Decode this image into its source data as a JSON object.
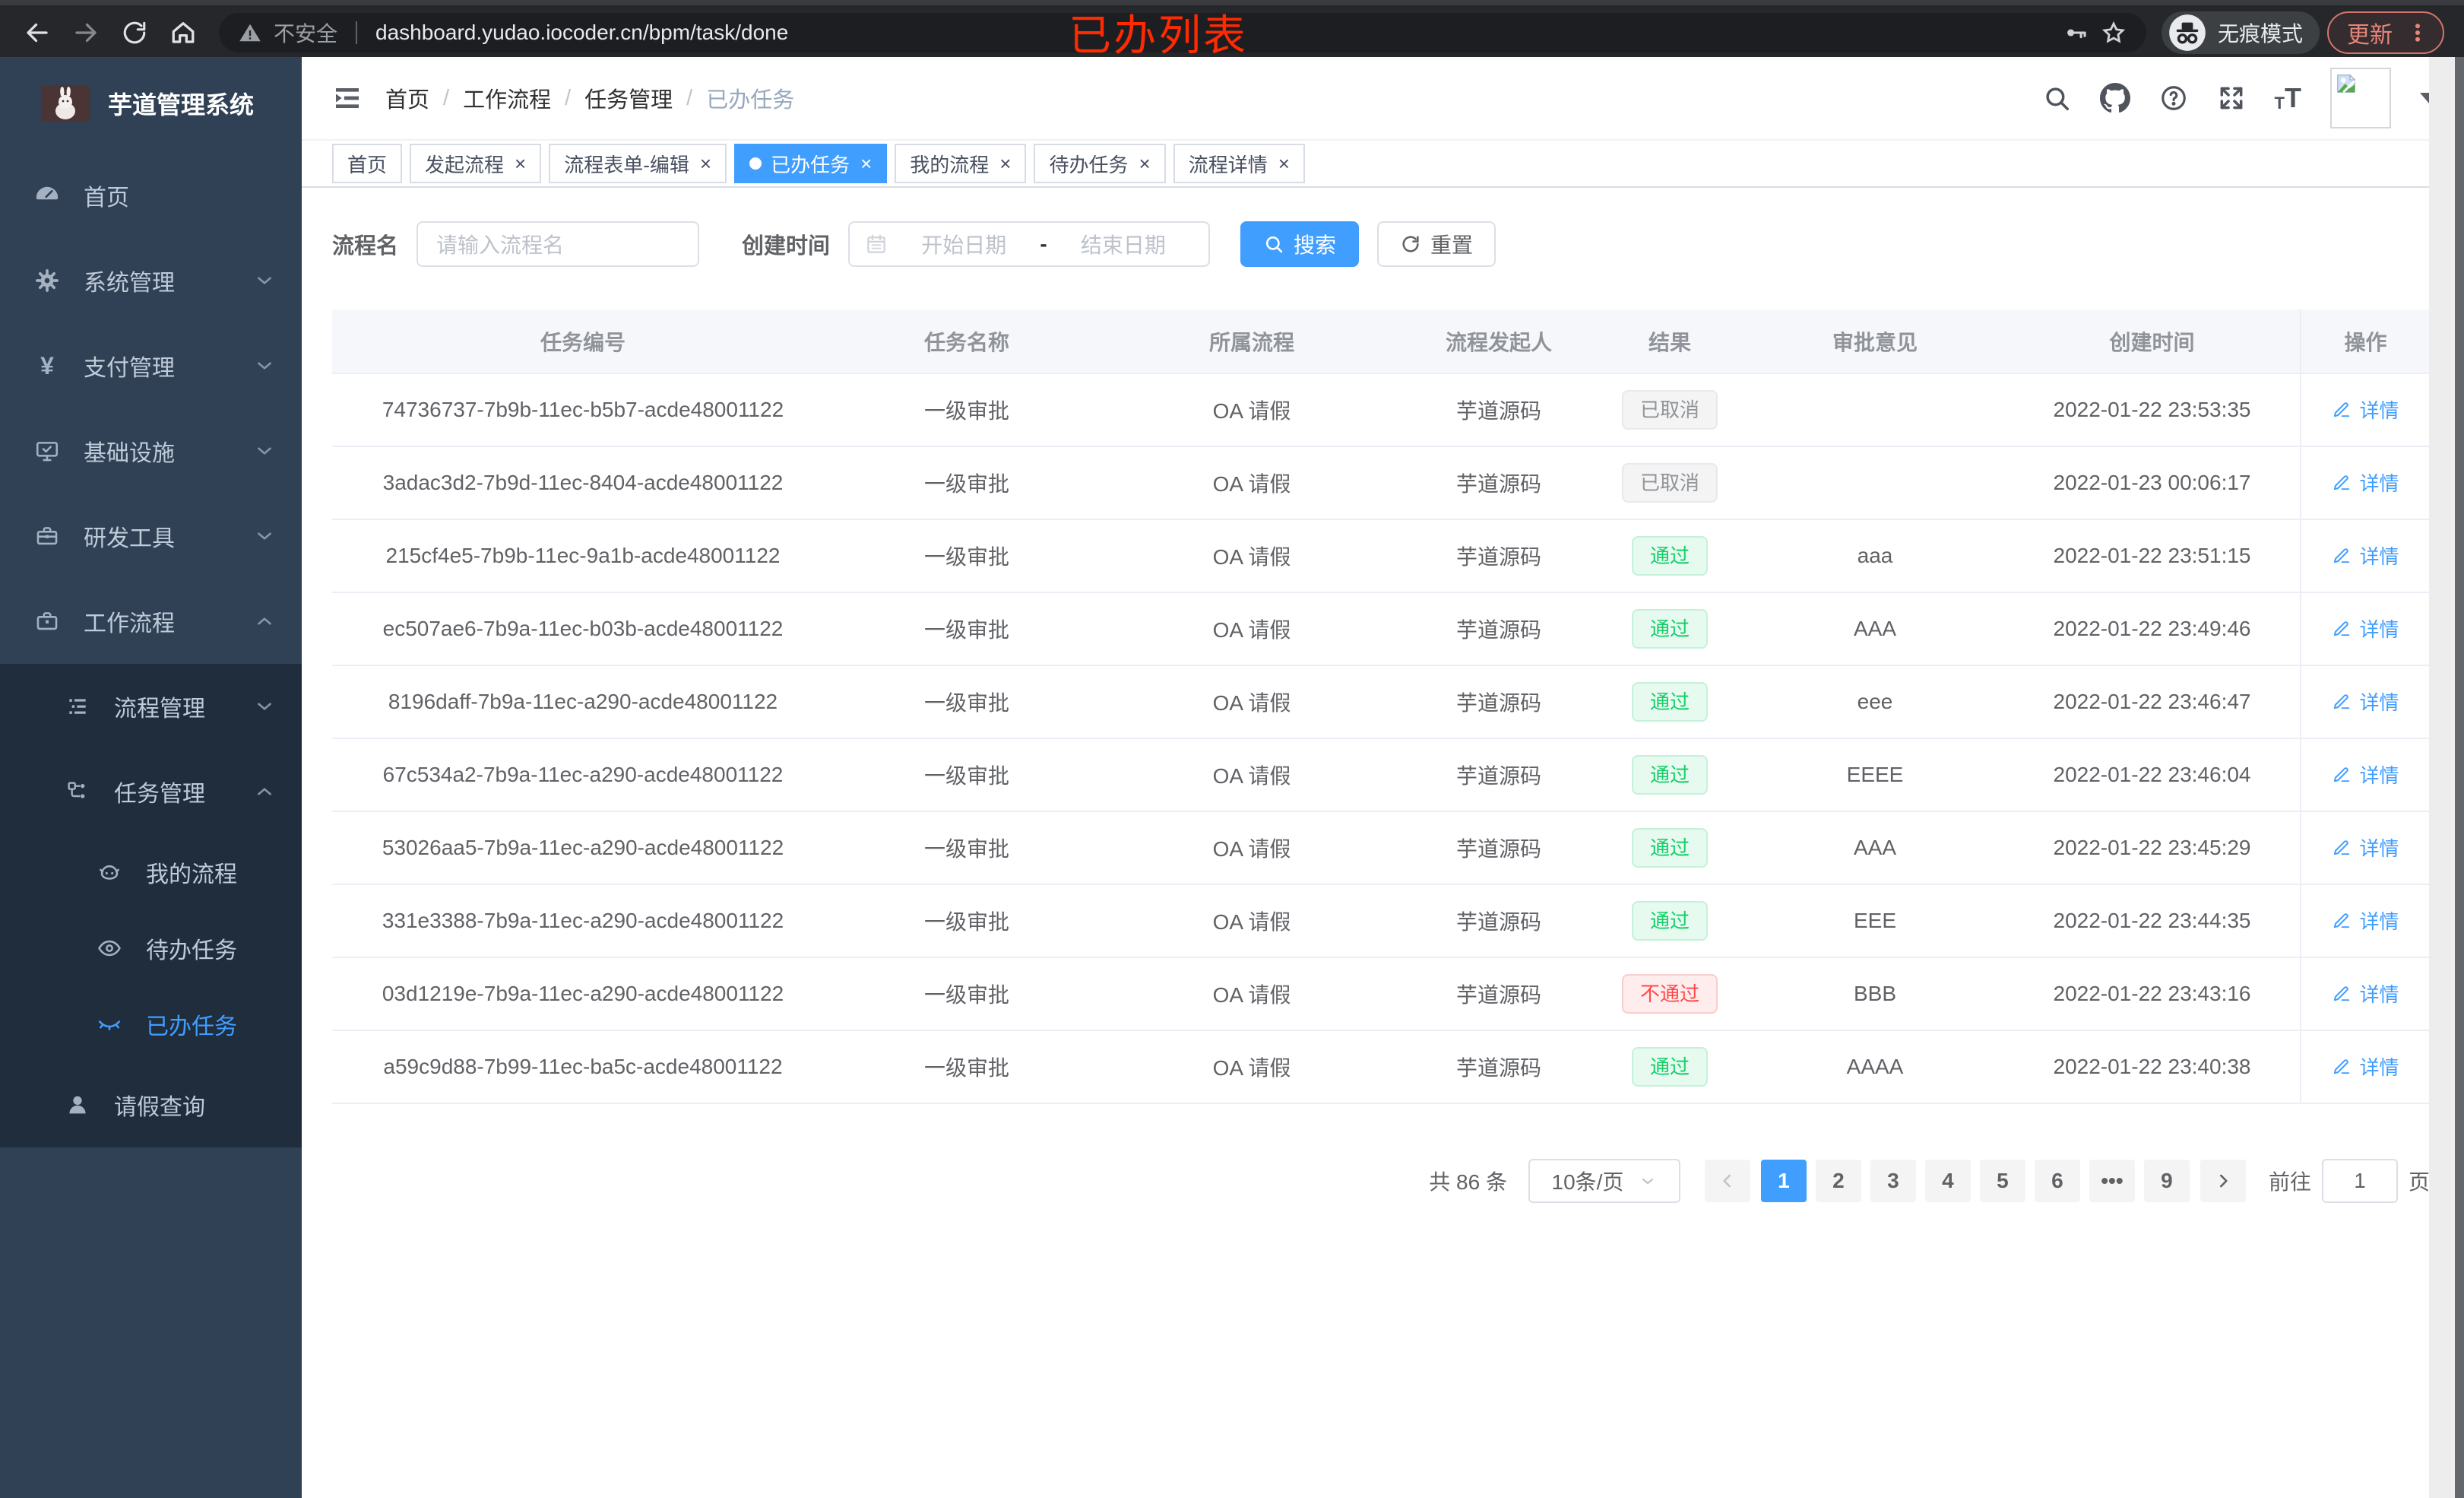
{
  "browser": {
    "security_label": "不安全",
    "url": "dashboard.yudao.iocoder.cn/bpm/task/done",
    "incognito_label": "无痕模式",
    "update_label": "更新"
  },
  "annotation": {
    "text": "已办列表",
    "color": "#ff2a00"
  },
  "sidebar": {
    "title": "芋道管理系统",
    "home": "首页",
    "system": "系统管理",
    "pay": "支付管理",
    "infra": "基础设施",
    "dev": "研发工具",
    "workflow": "工作流程",
    "process_mgmt": "流程管理",
    "task_mgmt": "任务管理",
    "my_process": "我的流程",
    "todo_tasks": "待办任务",
    "done_tasks": "已办任务",
    "leave_query": "请假查询"
  },
  "navbar": {
    "breadcrumb": [
      "首页",
      "工作流程",
      "任务管理",
      "已办任务"
    ]
  },
  "tabs": [
    {
      "label": "首页"
    },
    {
      "label": "发起流程"
    },
    {
      "label": "流程表单-编辑"
    },
    {
      "label": "已办任务",
      "active": true
    },
    {
      "label": "我的流程"
    },
    {
      "label": "待办任务"
    },
    {
      "label": "流程详情"
    }
  ],
  "filters": {
    "name_label": "流程名",
    "name_placeholder": "请输入流程名",
    "time_label": "创建时间",
    "start_placeholder": "开始日期",
    "range_separator": "-",
    "end_placeholder": "结束日期",
    "search_label": "搜索",
    "reset_label": "重置"
  },
  "table": {
    "columns": [
      "任务编号",
      "任务名称",
      "所属流程",
      "流程发起人",
      "结果",
      "审批意见",
      "创建时间",
      "操作"
    ],
    "action_label": "详情",
    "rows": [
      {
        "id": "74736737-7b9b-11ec-b5b7-acde48001122",
        "name": "一级审批",
        "process": "OA 请假",
        "starter": "芋道源码",
        "result": "已取消",
        "result_type": "info",
        "comment": "",
        "created": "2022-01-22 23:53:35"
      },
      {
        "id": "3adac3d2-7b9d-11ec-8404-acde48001122",
        "name": "一级审批",
        "process": "OA 请假",
        "starter": "芋道源码",
        "result": "已取消",
        "result_type": "info",
        "comment": "",
        "created": "2022-01-23 00:06:17"
      },
      {
        "id": "215cf4e5-7b9b-11ec-9a1b-acde48001122",
        "name": "一级审批",
        "process": "OA 请假",
        "starter": "芋道源码",
        "result": "通过",
        "result_type": "success",
        "comment": "aaa",
        "created": "2022-01-22 23:51:15"
      },
      {
        "id": "ec507ae6-7b9a-11ec-b03b-acde48001122",
        "name": "一级审批",
        "process": "OA 请假",
        "starter": "芋道源码",
        "result": "通过",
        "result_type": "success",
        "comment": "AAA",
        "created": "2022-01-22 23:49:46"
      },
      {
        "id": "8196daff-7b9a-11ec-a290-acde48001122",
        "name": "一级审批",
        "process": "OA 请假",
        "starter": "芋道源码",
        "result": "通过",
        "result_type": "success",
        "comment": "eee",
        "created": "2022-01-22 23:46:47"
      },
      {
        "id": "67c534a2-7b9a-11ec-a290-acde48001122",
        "name": "一级审批",
        "process": "OA 请假",
        "starter": "芋道源码",
        "result": "通过",
        "result_type": "success",
        "comment": "EEEE",
        "created": "2022-01-22 23:46:04"
      },
      {
        "id": "53026aa5-7b9a-11ec-a290-acde48001122",
        "name": "一级审批",
        "process": "OA 请假",
        "starter": "芋道源码",
        "result": "通过",
        "result_type": "success",
        "comment": "AAA",
        "created": "2022-01-22 23:45:29"
      },
      {
        "id": "331e3388-7b9a-11ec-a290-acde48001122",
        "name": "一级审批",
        "process": "OA 请假",
        "starter": "芋道源码",
        "result": "通过",
        "result_type": "success",
        "comment": "EEE",
        "created": "2022-01-22 23:44:35"
      },
      {
        "id": "03d1219e-7b9a-11ec-a290-acde48001122",
        "name": "一级审批",
        "process": "OA 请假",
        "starter": "芋道源码",
        "result": "不通过",
        "result_type": "danger",
        "comment": "BBB",
        "created": "2022-01-22 23:43:16"
      },
      {
        "id": "a59c9d88-7b99-11ec-ba5c-acde48001122",
        "name": "一级审批",
        "process": "OA 请假",
        "starter": "芋道源码",
        "result": "通过",
        "result_type": "success",
        "comment": "AAAA",
        "created": "2022-01-22 23:40:38"
      }
    ]
  },
  "pagination": {
    "total_text": "共 86 条",
    "page_size": "10条/页",
    "pages": [
      {
        "label": "1",
        "active": true
      },
      {
        "label": "2"
      },
      {
        "label": "3"
      },
      {
        "label": "4"
      },
      {
        "label": "5"
      },
      {
        "label": "6"
      },
      {
        "label": "•••"
      },
      {
        "label": "9"
      }
    ],
    "goto_label": "前往",
    "goto_value": "1",
    "goto_unit": "页"
  },
  "colors": {
    "primary": "#409eff",
    "success": "#13ce66",
    "danger": "#ff4949",
    "info": "#909399",
    "sidebar_bg": "#304156",
    "submenu_bg": "#1f2d3d",
    "annotation_red": "#ff2a00"
  },
  "icons": {
    "pay": "¥",
    "font_size": "tT"
  }
}
